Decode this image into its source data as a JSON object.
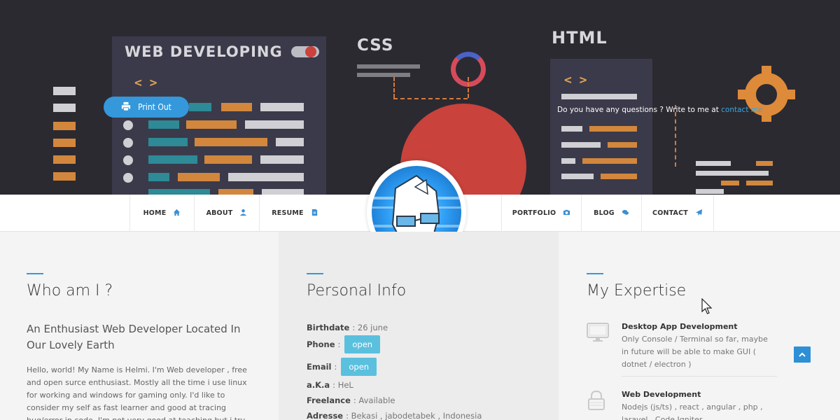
{
  "hero": {
    "deco_web_title": "WEB DEVELOPING",
    "deco_css": "CSS",
    "deco_html": "HTML",
    "deco_code_tag": "< >",
    "print_button": {
      "label": "Print Out",
      "icon": "printer-icon"
    },
    "question_text": "Do you have any questions ? Write to me at ",
    "contact_link": "contact me"
  },
  "nav": {
    "items": [
      {
        "label": "HOME",
        "icon": "home-icon"
      },
      {
        "label": "ABOUT",
        "icon": "user-icon"
      },
      {
        "label": "RESUME",
        "icon": "file-icon"
      },
      {
        "label": "PORTFOLIO",
        "icon": "camera-icon"
      },
      {
        "label": "BLOG",
        "icon": "comments-icon"
      },
      {
        "label": "CONTACT",
        "icon": "paper-plane-icon"
      }
    ],
    "avatar": "avatar-icon"
  },
  "about": {
    "title": "Who am I ?",
    "subtitle": "An Enthusiast Web Developer Located In Our Lovely Earth",
    "body": "Hello, world! My Name is Helmi. I'm Web developer , free and open surce enthusiast. Mostly all the time i use linux for working and windows for gaming only. I'd like to consider my self as fast learner and good at tracing bug/error in code. I'm not very good at teaching but i try as often as possible to help is coder"
  },
  "personal": {
    "title": "Personal Info",
    "birthdate_label": "Birthdate",
    "birthdate_value": ": 26 june",
    "phone_label": "Phone",
    "phone_sep": ":",
    "phone_button": "open",
    "email_label": "Email",
    "email_sep": ":",
    "email_button": "open",
    "aka_label": "a.K.a",
    "aka_value": ": HeL",
    "freelance_label": "Freelance",
    "freelance_value": ": Available",
    "address_label": "Adresse",
    "address_value": ": Bekasi , jabodetabek , Indonesia"
  },
  "expertise": {
    "title": "My Expertise",
    "items": [
      {
        "icon": "desktop-icon",
        "title": "Desktop App Development",
        "desc": "Only Console / Terminal so far, maybe in future will be able to make GUI ( dotnet / electron )"
      },
      {
        "icon": "lock-icon",
        "title": "Web Development",
        "desc": "Nodejs (js/ts) , react , angular , php , laravel , Code Igniter"
      }
    ]
  },
  "colors": {
    "accent": "#3498db",
    "hero_bg": "#2b2a31",
    "open_button": "#5bc0de",
    "scroll_top": "#2d8fd5"
  }
}
